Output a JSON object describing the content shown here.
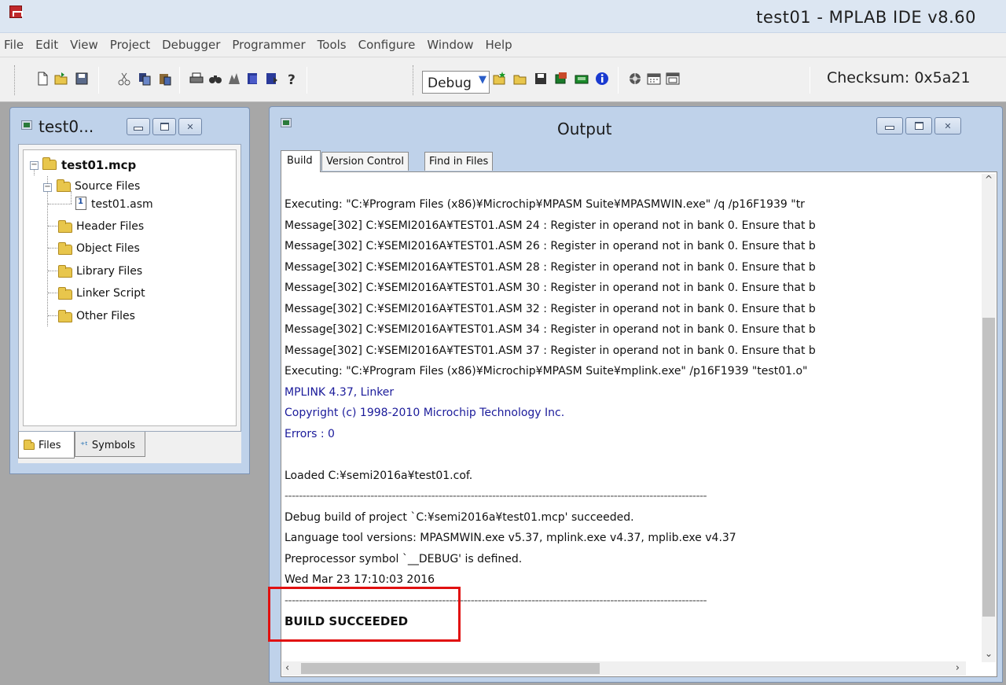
{
  "window": {
    "title": "test01 - MPLAB IDE v8.60"
  },
  "menu": [
    "File",
    "Edit",
    "View",
    "Project",
    "Debugger",
    "Programmer",
    "Tools",
    "Configure",
    "Window",
    "Help"
  ],
  "toolbar": {
    "build_config": "Debug",
    "checksum": "Checksum: 0x5a21",
    "icons": [
      "new-file-icon",
      "open-file-icon",
      "save-icon",
      "cut-icon",
      "copy-icon",
      "paste-icon",
      "print-icon",
      "find-icon",
      "find-in-files-icon",
      "bookmark-icon",
      "bookmark-next-icon",
      "help-icon",
      "new-project-icon",
      "open-project-icon",
      "save-project-icon",
      "build-icon",
      "build-all-icon",
      "info-icon",
      "program-icon",
      "calendar-icon",
      "window-icon"
    ]
  },
  "project_window": {
    "title": "test0...",
    "tree": {
      "project": "test01.mcp",
      "groups": [
        {
          "label": "Source Files",
          "expanded": true,
          "files": [
            "test01.asm"
          ]
        },
        {
          "label": "Header Files"
        },
        {
          "label": "Object Files"
        },
        {
          "label": "Library Files"
        },
        {
          "label": "Linker Script"
        },
        {
          "label": "Other Files"
        }
      ]
    },
    "tabs": [
      "Files",
      "Symbols"
    ]
  },
  "output_window": {
    "title": "Output",
    "tabs": [
      "Build",
      "Version Control",
      "Find in Files"
    ],
    "active_tab": "Build",
    "lines": [
      {
        "text": "Executing: \"C:¥Program Files (x86)¥Microchip¥MPASM Suite¥MPASMWIN.exe\" /q /p16F1939 \"tr",
        "style": "normal"
      },
      {
        "text": "Message[302] C:¥SEMI2016A¥TEST01.ASM 24 : Register in operand not in bank 0.  Ensure that b",
        "style": "normal"
      },
      {
        "text": "Message[302] C:¥SEMI2016A¥TEST01.ASM 26 : Register in operand not in bank 0.  Ensure that b",
        "style": "normal"
      },
      {
        "text": "Message[302] C:¥SEMI2016A¥TEST01.ASM 28 : Register in operand not in bank 0.  Ensure that b",
        "style": "normal"
      },
      {
        "text": "Message[302] C:¥SEMI2016A¥TEST01.ASM 30 : Register in operand not in bank 0.  Ensure that b",
        "style": "normal"
      },
      {
        "text": "Message[302] C:¥SEMI2016A¥TEST01.ASM 32 : Register in operand not in bank 0.  Ensure that b",
        "style": "normal"
      },
      {
        "text": "Message[302] C:¥SEMI2016A¥TEST01.ASM 34 : Register in operand not in bank 0.  Ensure that b",
        "style": "normal"
      },
      {
        "text": "Message[302] C:¥SEMI2016A¥TEST01.ASM 37 : Register in operand not in bank 0.  Ensure that b",
        "style": "normal"
      },
      {
        "text": "Executing: \"C:¥Program Files (x86)¥Microchip¥MPASM Suite¥mplink.exe\" /p16F1939 \"test01.o\"",
        "style": "normal"
      },
      {
        "text": "MPLINK 4.37, Linker",
        "style": "blue"
      },
      {
        "text": "Copyright (c) 1998-2010 Microchip Technology Inc.",
        "style": "blue"
      },
      {
        "text": "Errors    : 0",
        "style": "blue"
      },
      {
        "text": "",
        "style": "normal"
      },
      {
        "text": "Loaded C:¥semi2016a¥test01.cof.",
        "style": "normal"
      },
      {
        "text": "----------------------------------------------------------------------------------------------------------------------",
        "style": "dashes"
      },
      {
        "text": "Debug build of project `C:¥semi2016a¥test01.mcp' succeeded.",
        "style": "normal"
      },
      {
        "text": "Language tool versions: MPASMWIN.exe v5.37, mplink.exe v4.37, mplib.exe v4.37",
        "style": "normal"
      },
      {
        "text": "Preprocessor symbol `__DEBUG' is defined.",
        "style": "normal"
      },
      {
        "text": "Wed Mar 23 17:10:03 2016",
        "style": "normal"
      },
      {
        "text": "----------------------------------------------------------------------------------------------------------------------",
        "style": "dashes"
      },
      {
        "text": "BUILD SUCCEEDED",
        "style": "bold"
      }
    ]
  },
  "colors": {
    "highlight_box": "#e11010",
    "linker_text": "#1a1a9a",
    "window_frame": "#bfd2ea"
  }
}
